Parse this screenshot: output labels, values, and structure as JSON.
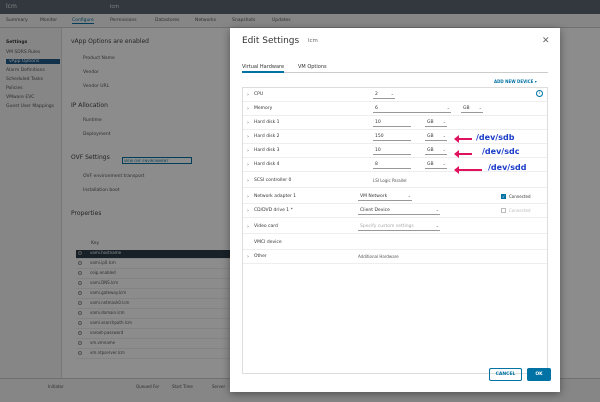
{
  "app": {
    "logo": "lcm",
    "vm_name": "lcm"
  },
  "bg_tabs": [
    "Summary",
    "Monitor",
    "Configure",
    "Permissions",
    "Datastores",
    "Networks",
    "Snapshots",
    "Updates"
  ],
  "bg_nav": {
    "header": "Settings",
    "items": [
      "VM SDRS Rules",
      "vApp Options",
      "Alarm Definitions",
      "Scheduled Tasks",
      "Policies",
      "VMware EVC",
      "Guest User Mappings"
    ]
  },
  "bg_main": {
    "heading": "vApp Options are enabled",
    "product_name": "Product Name",
    "vendor": "Vendor",
    "vendor_url": "Vendor URL",
    "ip_allocation": "IP Allocation",
    "ip_runtime": "Runtime",
    "ip_deployment": "Deployment",
    "ovf_settings": "OVF Settings",
    "ovf_button": "VIEW OVF ENVIRONMENT",
    "ovf_env": "OVF environment transport",
    "installation_boot": "Installation boot",
    "properties": "Properties",
    "prop_header": "Key",
    "properties_rows": [
      "vami.hostname",
      "vami.ip0.lcm",
      "ceip.enabled",
      "vami.DNS.lcm",
      "vami.gateway.lcm",
      "vami.netmask0.lcm",
      "vami.domain.lcm",
      "vami.searchpath.lcm",
      "varoot-password",
      "vm.vmname",
      "vm.ntpserver.lcm"
    ],
    "bottom": [
      "Initiator",
      "Queued For",
      "Start Time",
      "Server"
    ]
  },
  "modal": {
    "title": "Edit Settings",
    "subtitle": "lcm",
    "tabs": [
      "Virtual Hardware",
      "VM Options"
    ],
    "add_device": "ADD NEW DEVICE ▾",
    "info_icon": "i",
    "rows": [
      {
        "label": "CPU",
        "field": "2",
        "unit": ""
      },
      {
        "label": "Memory",
        "field": "6",
        "unit": "GB"
      },
      {
        "label": "Hard disk 1",
        "field": "10",
        "unit": "GB"
      },
      {
        "label": "Hard disk 2",
        "field": "150",
        "unit": "GB"
      },
      {
        "label": "Hard disk 3",
        "field": "10",
        "unit": "GB"
      },
      {
        "label": "Hard disk 4",
        "field": "8",
        "unit": "GB"
      },
      {
        "label": "SCSI controller 0",
        "value": "LSI Logic Parallel"
      },
      {
        "label": "Network adapter 1",
        "field": "VM Network",
        "check_label": "Connected"
      },
      {
        "label": "CD/DVD drive 1 *",
        "field": "Client Device",
        "check_label": "Connected"
      },
      {
        "label": "Video card",
        "value": "Specify custom settings"
      },
      {
        "label": "VMCI device",
        "value": ""
      },
      {
        "label": "Other",
        "value": "Additional Hardware"
      }
    ],
    "annotations": [
      "/dev/sdb",
      "/dev/sdc",
      "/dev/sdd"
    ],
    "cancel": "CANCEL",
    "ok": "OK"
  },
  "colors": {
    "accent": "#0072a3",
    "annotation_text": "#1a3cc8",
    "arrow": "#e0115f"
  }
}
